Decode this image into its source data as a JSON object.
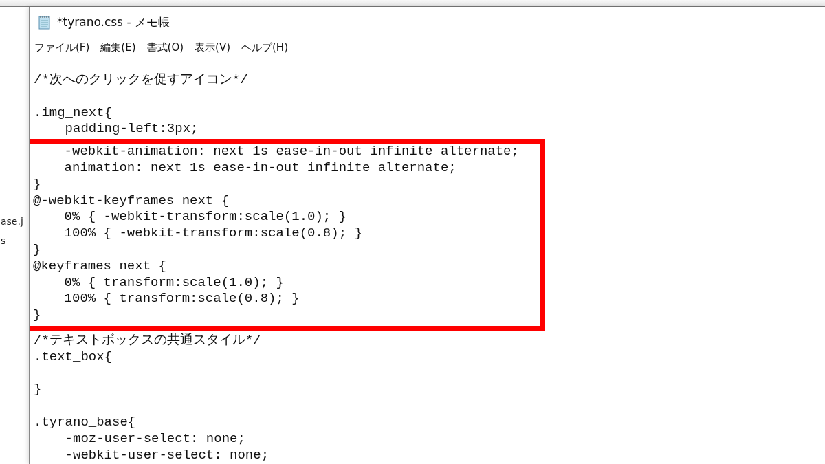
{
  "background_window": {
    "items": [
      "ase.j",
      "s"
    ]
  },
  "window": {
    "title": "*tyrano.css - メモ帳"
  },
  "menu": [
    "ファイル(F)",
    "編集(E)",
    "書式(O)",
    "表示(V)",
    "ヘルプ(H)"
  ],
  "editor": {
    "sections": [
      {
        "kind": "plain",
        "lines": [
          {
            "kind": "code",
            "text": "/*次へのクリックを促すアイコン*/"
          },
          {
            "kind": "blank"
          },
          {
            "kind": "code",
            "text": ".img_next{"
          },
          {
            "kind": "code",
            "text": "    padding-left:3px;"
          }
        ]
      },
      {
        "kind": "highlighted",
        "lines": [
          {
            "kind": "code",
            "text": "    -webkit-animation: next 1s ease-in-out infinite alternate;"
          },
          {
            "kind": "code",
            "text": "    animation: next 1s ease-in-out infinite alternate;"
          },
          {
            "kind": "code",
            "text": "}"
          },
          {
            "kind": "code",
            "text": "@-webkit-keyframes next {"
          },
          {
            "kind": "code",
            "text": "    0% { -webkit-transform:scale(1.0); }"
          },
          {
            "kind": "code",
            "text": "    100% { -webkit-transform:scale(0.8); }"
          },
          {
            "kind": "code",
            "text": "}"
          },
          {
            "kind": "code",
            "text": "@keyframes next {"
          },
          {
            "kind": "code",
            "text": "    0% { transform:scale(1.0); }"
          },
          {
            "kind": "code",
            "text": "    100% { transform:scale(0.8); }"
          },
          {
            "kind": "code",
            "text": "}"
          }
        ]
      },
      {
        "kind": "plain",
        "lines": [
          {
            "kind": "code",
            "text": "/*テキストボックスの共通スタイル*/"
          },
          {
            "kind": "code",
            "text": ".text_box{"
          },
          {
            "kind": "blank"
          },
          {
            "kind": "code",
            "text": "}"
          },
          {
            "kind": "blank"
          },
          {
            "kind": "code",
            "text": ".tyrano_base{"
          },
          {
            "kind": "code",
            "text": "    -moz-user-select: none;"
          },
          {
            "kind": "code",
            "text": "    -webkit-user-select: none;"
          }
        ]
      }
    ]
  }
}
